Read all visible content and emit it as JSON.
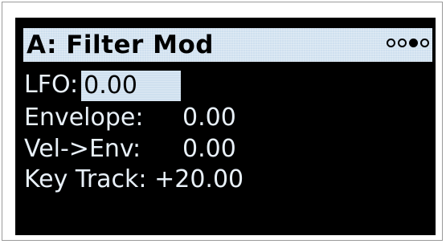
{
  "header": {
    "title": "A: Filter Mod",
    "pages": [
      {
        "icon": "page-dot-empty"
      },
      {
        "icon": "page-dot-empty"
      },
      {
        "icon": "page-dot-filled",
        "active": true
      },
      {
        "icon": "page-dot-empty"
      }
    ]
  },
  "params": {
    "lfo": {
      "label": "LFO:",
      "value": "0.00"
    },
    "envelope": {
      "label": "Envelope:",
      "value": "0.00"
    },
    "vel_env": {
      "label": "Vel->Env:",
      "value": "0.00"
    },
    "key_track": {
      "label": "Key Track:",
      "value": "+20.00"
    }
  },
  "colors": {
    "screen_bg": "#000000",
    "highlight": "#cfe0ef",
    "text": "#e8f0f8"
  }
}
